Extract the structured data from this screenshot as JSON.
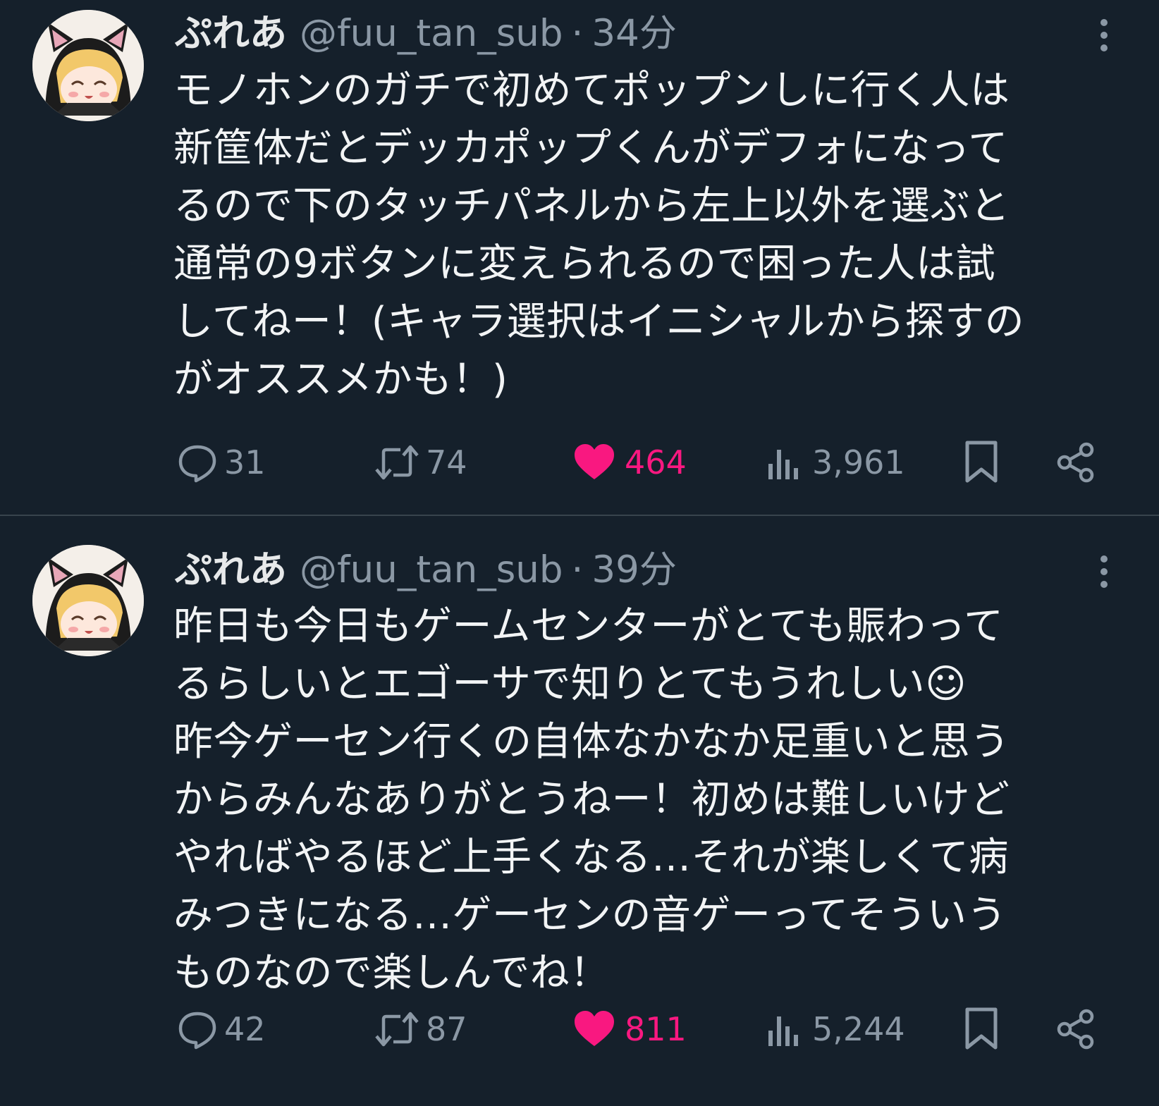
{
  "tweets": [
    {
      "display_name": "ぷれあ",
      "handle": "@fuu_tan_sub",
      "separator": "·",
      "time": "34分",
      "text_lines": [
        "モノホンのガチで初めてポップンしに行く人は",
        "新筐体だとデッカポップくんがデフォになって",
        "るので下のタッチパネルから左上以外を選ぶと",
        "通常の9ボタンに変えられるので困った人は試",
        "してねー！(キャラ選択はイニシャルから探すの",
        "がオススメかも！)"
      ],
      "replies": "31",
      "retweets": "74",
      "likes": "464",
      "views": "3,961"
    },
    {
      "display_name": "ぷれあ",
      "handle": "@fuu_tan_sub",
      "separator": "·",
      "time": "39分",
      "text_lines": [
        "昨日も今日もゲームセンターがとても賑わって",
        "るらしいとエゴーサで知りとてもうれしい☺",
        "昨今ゲーセン行くの自体なかなか足重いと思う",
        "からみんなありがとうねー！初めは難しいけど",
        "やればやるほど上手くなる…それが楽しくて病",
        "みつきになる…ゲーセンの音ゲーってそういう",
        "ものなので楽しんでね！"
      ],
      "replies": "42",
      "retweets": "87",
      "likes": "811",
      "views": "5,244"
    }
  ],
  "icons": {
    "reply": "speech-bubble-icon",
    "retweet": "retweet-arrows-icon",
    "like": "heart-filled-icon",
    "views": "bar-chart-icon",
    "bookmark": "bookmark-icon",
    "share": "share-nodes-icon",
    "more": "vertical-ellipsis-icon"
  },
  "colors": {
    "background": "#15202b",
    "text": "#f2f4f5",
    "muted": "#8b98a5",
    "like": "#f91880",
    "divider": "#38444d"
  }
}
